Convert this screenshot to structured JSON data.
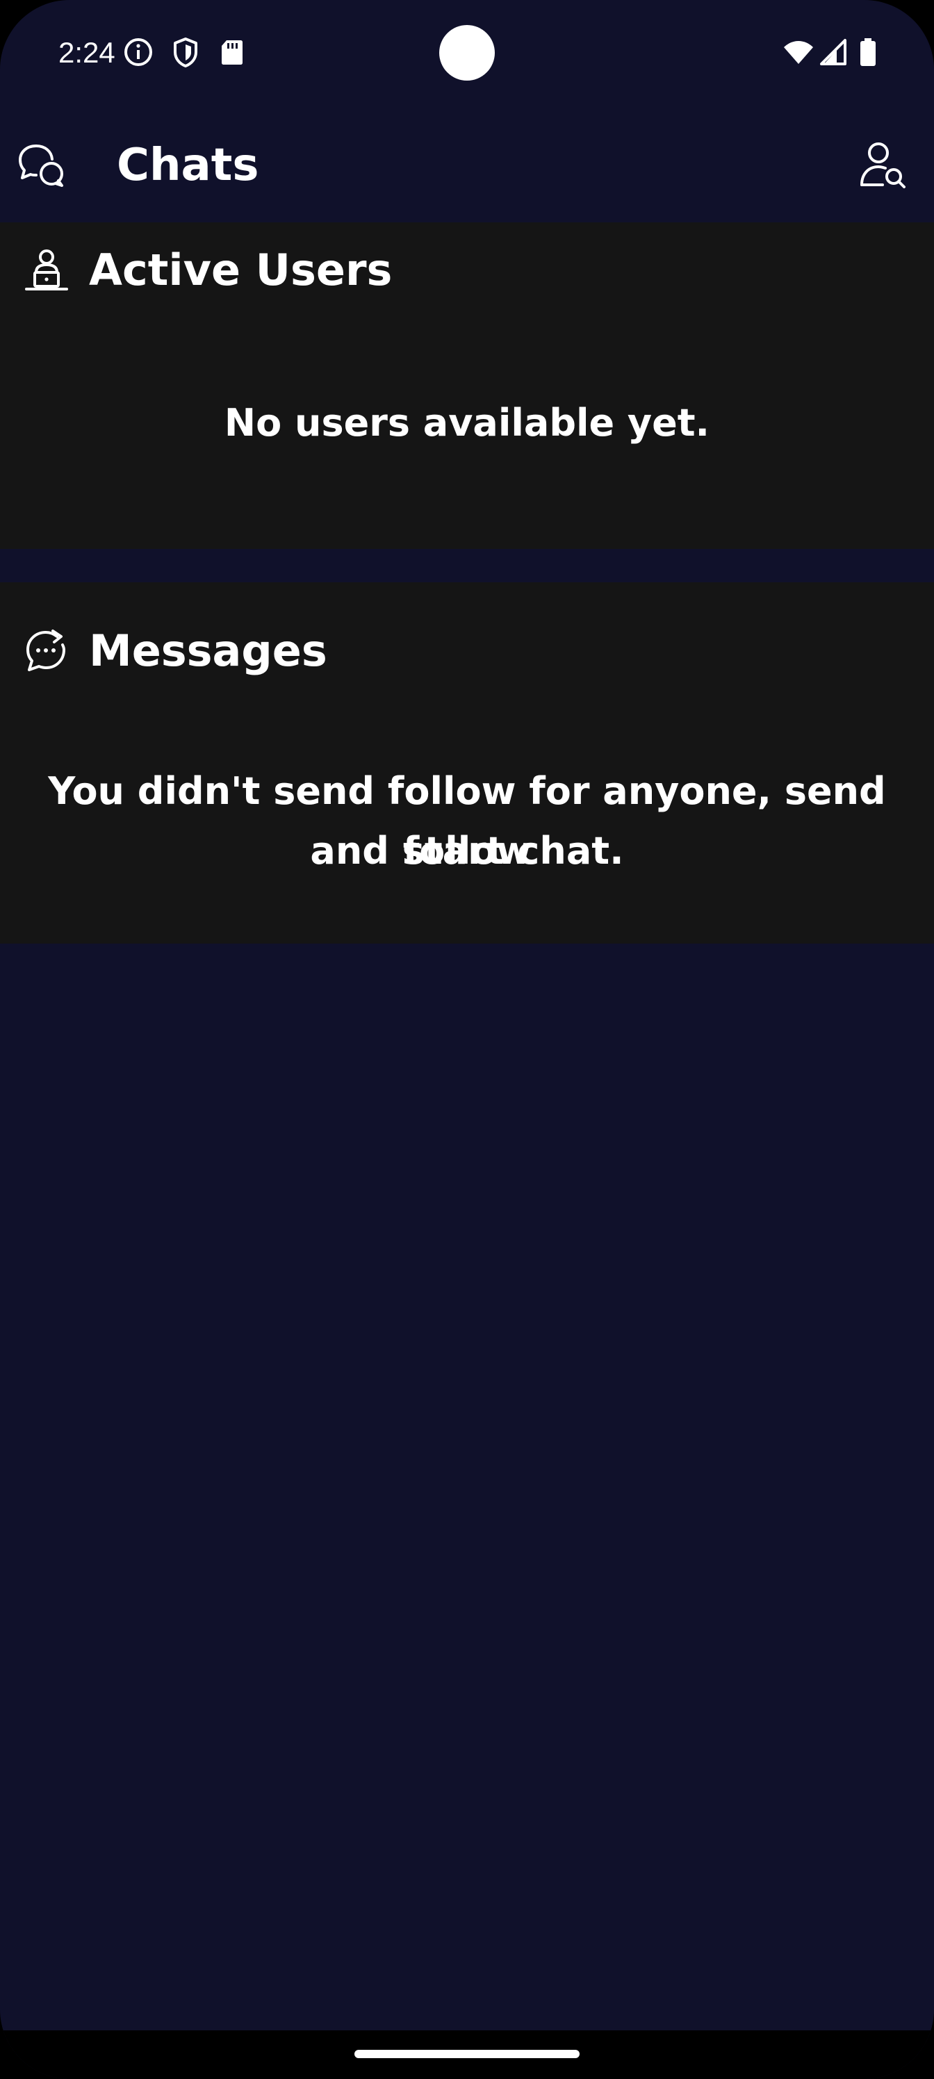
{
  "status_bar": {
    "time": "2:24",
    "icons": [
      "info-icon",
      "shield-icon",
      "sd-card-icon",
      "wifi-icon",
      "cell-signal-icon",
      "battery-icon"
    ]
  },
  "app_bar": {
    "title": "Chats",
    "left_icon": "chat-bubbles-icon",
    "right_icon": "user-search-icon"
  },
  "active_users": {
    "title": "Active Users",
    "icon": "user-laptop-icon",
    "empty_message": "No users available yet."
  },
  "messages": {
    "title": "Messages",
    "icon": "chat-forward-icon",
    "empty_line_1": "You didn't send follow for anyone, send follow",
    "empty_line_2": "and start chat."
  },
  "colors": {
    "background": "#10112b",
    "section_background": "#151515",
    "text": "#ffffff"
  }
}
